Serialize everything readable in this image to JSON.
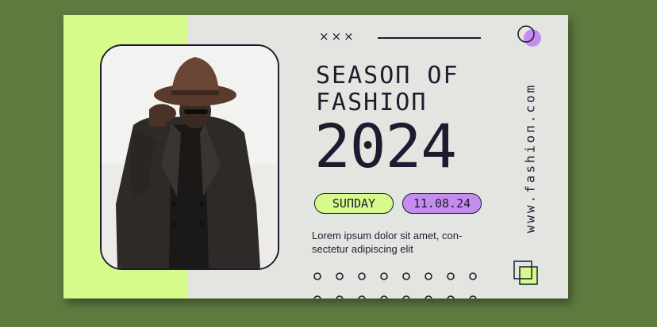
{
  "card": {
    "title_line1": "SEASOП OF",
    "title_line2": "FASHIOП",
    "year": "2024",
    "day_label": "SUПDAY",
    "date_label": "11.08.24",
    "description_line1": "Lorem ipsum dolor sit amet, con-",
    "description_line2": "sectetur adipiscing elit",
    "website": "www.fashioп.com",
    "x_marks": "×××"
  },
  "colors": {
    "background": "#5d7a3f",
    "card": "#e3e6e0",
    "accent_green": "#d6fb8a",
    "accent_purple": "#c58cf0",
    "ink": "#1c1c2e"
  },
  "icons": [
    "circle-outline-icon",
    "purple-circle-icon",
    "overlapping-squares-icon"
  ]
}
